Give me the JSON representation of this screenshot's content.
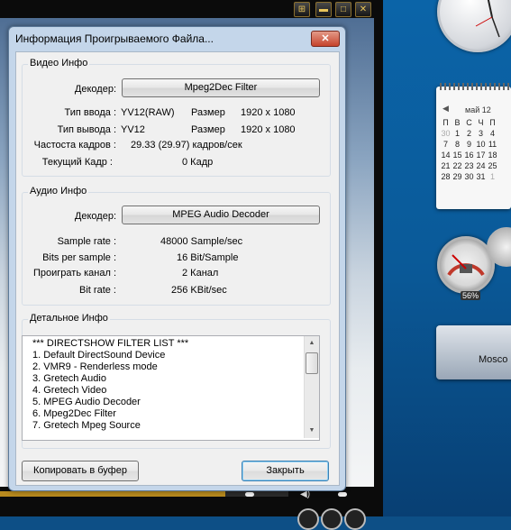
{
  "dialog": {
    "title": "Информация Проигрываемого Файла...",
    "close": "✕"
  },
  "video": {
    "group_title": "Видео Инфо",
    "decoder_label": "Декодер:",
    "decoder_value": "Mpeg2Dec Filter",
    "input_type_label": "Тип ввода :",
    "input_type_value": "YV12(RAW)",
    "input_size_label": "Размер",
    "input_size_value": "1920 x 1080",
    "output_type_label": "Тип вывода :",
    "output_type_value": "YV12",
    "output_size_label": "Размер",
    "output_size_value": "1920 x 1080",
    "framerate_label": "Частоста кадров :",
    "framerate_value": "29.33 (29.97) кадров/сек",
    "current_frame_label": "Текущий Кадр :",
    "current_frame_value": "0 Кадр"
  },
  "audio": {
    "group_title": "Аудио Инфо",
    "decoder_label": "Декодер:",
    "decoder_value": "MPEG Audio Decoder",
    "sample_rate_label": "Sample rate :",
    "sample_rate_value": "48000 Sample/sec",
    "bits_label": "Bits per sample :",
    "bits_value": "16 Bit/Sample",
    "channels_label": "Проиграть канал :",
    "channels_value": "2 Канал",
    "bitrate_label": "Bit rate :",
    "bitrate_value": "256 KBit/sec"
  },
  "details": {
    "group_title": "Детальное Инфо",
    "lines": [
      "*** DIRECTSHOW FILTER LIST ***",
      "1. Default DirectSound Device",
      "2. VMR9 - Renderless mode",
      "3. Gretech Audio",
      "4. Gretech Video",
      "5. MPEG Audio Decoder",
      "6. Mpeg2Dec Filter",
      "7. Gretech Mpeg Source"
    ]
  },
  "buttons": {
    "copy": "Копировать в буфер",
    "close": "Закрыть"
  },
  "player": {
    "controls": [
      "⊞",
      "▬",
      "□",
      "✕"
    ],
    "seek_progress": 0.78
  },
  "gadgets": {
    "calendar": {
      "month": "май 12",
      "nav": "◀",
      "headers": [
        "П",
        "В",
        "С",
        "Ч",
        "П"
      ],
      "days": [
        "30",
        "1",
        "2",
        "3",
        "4",
        "7",
        "8",
        "9",
        "10",
        "11",
        "14",
        "15",
        "16",
        "17",
        "18",
        "21",
        "22",
        "23",
        "24",
        "25",
        "28",
        "29",
        "30",
        "31",
        "1"
      ]
    },
    "cpu_meter_value": "56%",
    "weather_city": "Mosco"
  }
}
